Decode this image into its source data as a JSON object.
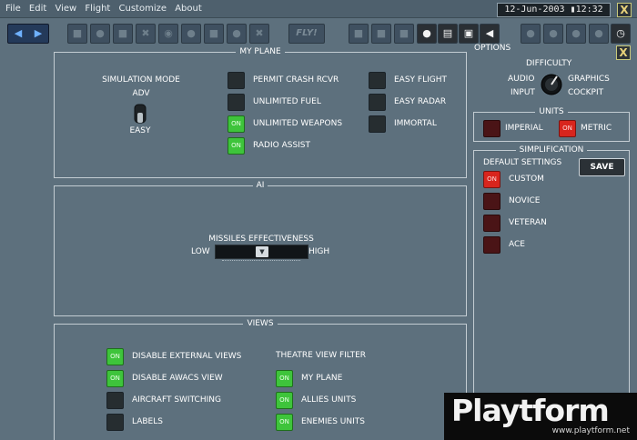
{
  "menu": [
    "File",
    "Edit",
    "View",
    "Flight",
    "Customize",
    "About"
  ],
  "clock": "12-Jun-2003 ▮12:32",
  "close_label": "X",
  "fly_label": "FLY!",
  "options": {
    "title": "OPTIONS",
    "difficulty": "DIFFICULTY",
    "audio": "AUDIO",
    "graphics": "GRAPHICS",
    "input": "INPUT",
    "cockpit": "COCKPIT"
  },
  "my_plane": {
    "title": "MY PLANE",
    "simulation_mode": "SIMULATION MODE",
    "adv": "ADV",
    "easy": "EASY",
    "toggles": [
      {
        "label": "PERMIT CRASH RCVR",
        "state": "off",
        "text": ""
      },
      {
        "label": "UNLIMITED FUEL",
        "state": "off",
        "text": ""
      },
      {
        "label": "UNLIMITED WEAPONS",
        "state": "on",
        "text": "ON"
      },
      {
        "label": "RADIO ASSIST",
        "state": "on",
        "text": "ON"
      },
      {
        "label": "EASY FLIGHT",
        "state": "off",
        "text": ""
      },
      {
        "label": "EASY RADAR",
        "state": "off",
        "text": ""
      },
      {
        "label": "IMMORTAL",
        "state": "off",
        "text": ""
      }
    ]
  },
  "ai": {
    "title": "AI",
    "missiles_label": "MISSILES EFFECTIVENESS",
    "low": "LOW",
    "high": "HIGH",
    "level": 0.5
  },
  "views": {
    "title": "VIEWS",
    "theatre_filter": "THEATRE VIEW FILTER",
    "left": [
      {
        "label": "DISABLE EXTERNAL VIEWS",
        "state": "on",
        "text": "ON"
      },
      {
        "label": "DISABLE AWACS VIEW",
        "state": "on",
        "text": "ON"
      },
      {
        "label": "AIRCRAFT SWITCHING",
        "state": "off",
        "text": ""
      },
      {
        "label": "LABELS",
        "state": "off",
        "text": ""
      }
    ],
    "right": [
      {
        "label": "MY PLANE",
        "state": "on",
        "text": "ON"
      },
      {
        "label": "ALLIES UNITS",
        "state": "on",
        "text": "ON"
      },
      {
        "label": "ENEMIES UNITS",
        "state": "on",
        "text": "ON"
      }
    ]
  },
  "units": {
    "title": "UNITS",
    "imperial": {
      "label": "IMPERIAL",
      "state": "off",
      "text": ""
    },
    "metric": {
      "label": "METRIC",
      "state": "on",
      "text": "ON"
    }
  },
  "simplification": {
    "title": "SIMPLIFICATION",
    "default_settings": "DEFAULT SETTINGS",
    "save": "SAVE",
    "options": [
      {
        "label": "CUSTOM",
        "state": "on",
        "text": "ON"
      },
      {
        "label": "NOVICE",
        "state": "off",
        "text": ""
      },
      {
        "label": "VETERAN",
        "state": "off",
        "text": ""
      },
      {
        "label": "ACE",
        "state": "off",
        "text": ""
      }
    ]
  },
  "watermark": {
    "brand": "Playtform",
    "url": "www.playtform.net"
  }
}
